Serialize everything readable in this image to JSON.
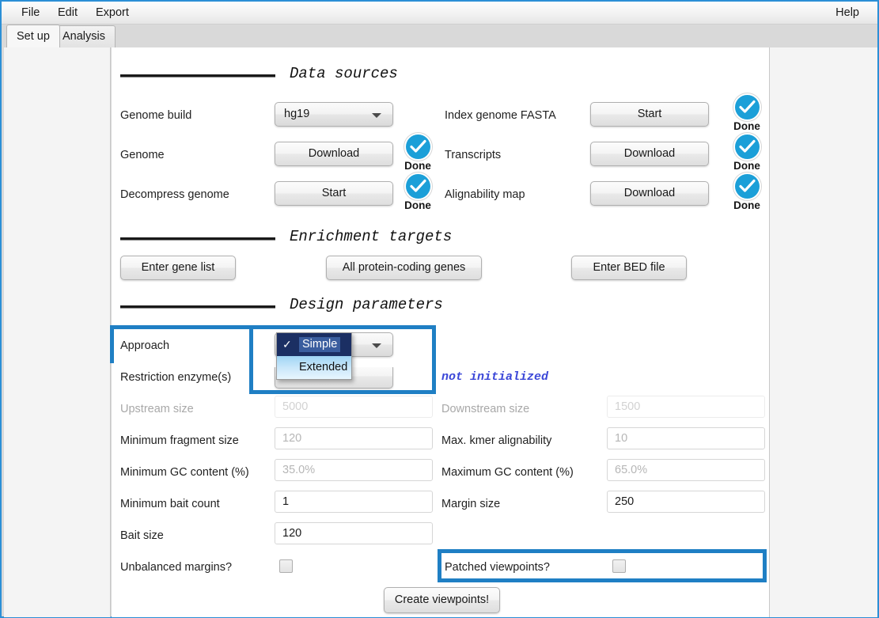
{
  "window": {
    "accent_color": "#2b8fd6",
    "highlight_color": "#1f7fc4"
  },
  "menu": {
    "items": [
      {
        "label": "File"
      },
      {
        "label": "Edit"
      },
      {
        "label": "Export"
      }
    ],
    "help_label": "Help"
  },
  "tabs": [
    {
      "label": "Set up",
      "active": true
    },
    {
      "label": "Analysis",
      "active": false
    }
  ],
  "sections": {
    "data_sources": {
      "title": "Data sources",
      "rows": [
        {
          "label": "Genome build",
          "control": "combobox",
          "value": "hg19"
        },
        {
          "label": "Genome",
          "control": "button",
          "button_label": "Download",
          "status": "Done"
        },
        {
          "label": "Decompress genome",
          "control": "button",
          "button_label": "Start",
          "status": "Done"
        },
        {
          "label": "Index genome FASTA",
          "control": "button",
          "button_label": "Start",
          "status": "Done"
        },
        {
          "label": "Transcripts",
          "control": "button",
          "button_label": "Download",
          "status": "Done"
        },
        {
          "label": "Alignability map",
          "control": "button",
          "button_label": "Download",
          "status": "Done"
        }
      ]
    },
    "enrichment_targets": {
      "title": "Enrichment targets",
      "buttons": [
        {
          "label": "Enter gene list"
        },
        {
          "label": "All protein-coding genes"
        },
        {
          "label": "Enter BED file"
        }
      ]
    },
    "design_parameters": {
      "title": "Design parameters",
      "approach": {
        "label": "Approach",
        "selected": "Simple",
        "options": [
          {
            "label": "Simple",
            "selected": true
          },
          {
            "label": "Extended",
            "selected": false
          }
        ],
        "check_glyph": "✓"
      },
      "restriction_enzymes": {
        "label": "Restriction enzyme(s)",
        "status": "not initialized"
      },
      "fields": [
        {
          "label": "Upstream size",
          "value": "",
          "placeholder": "5000",
          "disabled": true
        },
        {
          "label": "Downstream size",
          "value": "",
          "placeholder": "1500",
          "disabled": true
        },
        {
          "label": "Minimum fragment size",
          "value": "",
          "placeholder": "120",
          "disabled": false
        },
        {
          "label": "Max. kmer alignability",
          "value": "",
          "placeholder": "10",
          "disabled": false
        },
        {
          "label": "Minimum GC content (%)",
          "value": "",
          "placeholder": "35.0%",
          "disabled": false
        },
        {
          "label": "Maximum GC content (%)",
          "value": "",
          "placeholder": "65.0%",
          "disabled": false
        },
        {
          "label": "Minimum bait count",
          "value": "1",
          "placeholder": "",
          "disabled": false
        },
        {
          "label": "Margin size",
          "value": "250",
          "placeholder": "",
          "disabled": false
        },
        {
          "label": "Bait size",
          "value": "120",
          "placeholder": "",
          "disabled": false
        }
      ],
      "checkboxes": [
        {
          "label": "Unbalanced margins?",
          "checked": false
        },
        {
          "label": "Patched viewpoints?",
          "checked": false
        }
      ],
      "submit_label": "Create viewpoints!"
    }
  }
}
